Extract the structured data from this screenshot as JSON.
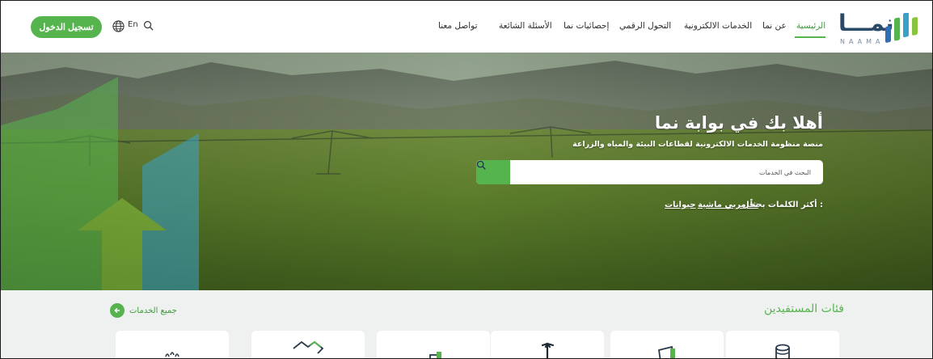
{
  "header": {
    "login_label": "تسجيل الدخول",
    "lang_label": "En",
    "nav": [
      {
        "label": "الرئيسية",
        "active": true
      },
      {
        "label": "عن نما"
      },
      {
        "label": "الخدمات الالكترونية"
      },
      {
        "label": "التحول الرقمي"
      },
      {
        "label": "إحصائيات نما"
      },
      {
        "label": "الأسئلة الشائعة"
      },
      {
        "label": "تواصل معنا"
      }
    ],
    "logo": {
      "arabic": "نمـــا",
      "latin": "NAAMA"
    }
  },
  "hero": {
    "title": "أهلا بك في بوابة نما",
    "subtitle": "منصة منظومة الخدمات الالكترونية لقطاعات البيئة والمياه والزراعة",
    "search": {
      "placeholder": "البحث في الخدمات"
    },
    "keywords_label": "أكثر الكلمات بحثاً :",
    "keywords": [
      "نحل",
      "مربي ماشية",
      "حيوانات"
    ]
  },
  "beneficiaries": {
    "title": "فئات المستفيدين",
    "all_services_label": "جميع الخدمات",
    "categories": [
      {
        "icon": "database-icon"
      },
      {
        "icon": "document-icon"
      },
      {
        "icon": "palm-tree-icon"
      },
      {
        "icon": "truck-icon"
      },
      {
        "icon": "handshake-icon"
      },
      {
        "icon": "plant-icon"
      }
    ]
  },
  "colors": {
    "accent": "#56b44e",
    "logo_navy": "#2a4a6a"
  }
}
